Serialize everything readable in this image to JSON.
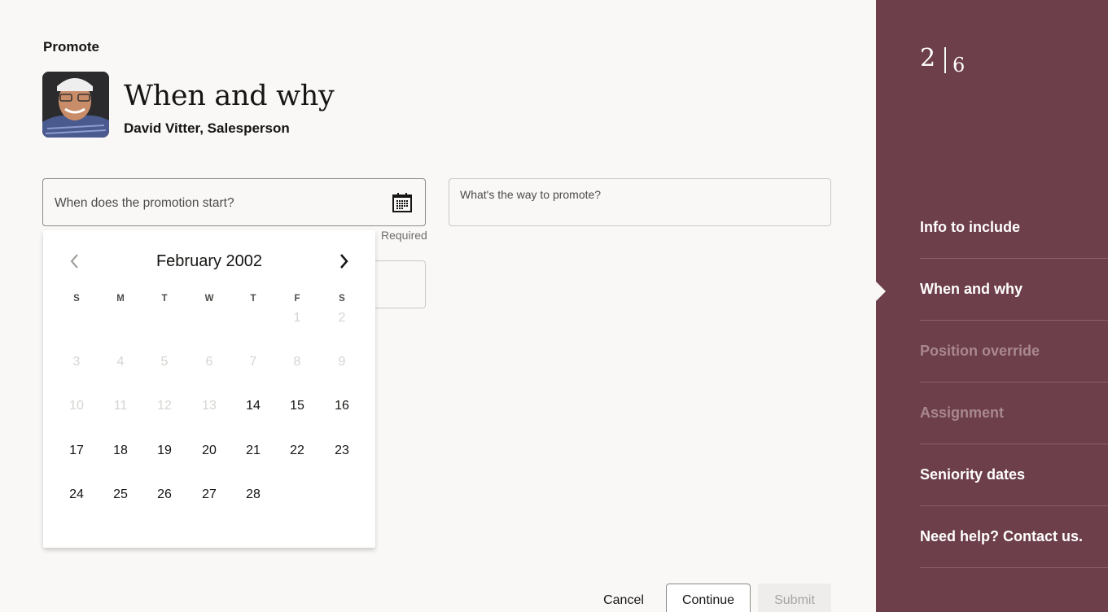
{
  "header": {
    "eyebrow": "Promote",
    "title": "When and why",
    "subtitle": "David Vitter, Salesperson"
  },
  "form": {
    "start_date": {
      "placeholder": "When does the promotion start?",
      "helper": "Required",
      "icon": "calendar-icon"
    },
    "way": {
      "placeholder": "What's the way to promote?"
    }
  },
  "datepicker": {
    "month_label": "February 2002",
    "prev_icon": "chevron-left-icon",
    "next_icon": "chevron-right-icon",
    "weekdays": [
      "S",
      "M",
      "T",
      "W",
      "T",
      "F",
      "S"
    ],
    "weeks": [
      [
        null,
        null,
        null,
        null,
        null,
        {
          "d": "1",
          "disabled": true
        },
        {
          "d": "2",
          "disabled": true
        }
      ],
      [
        {
          "d": "3",
          "disabled": true
        },
        {
          "d": "4",
          "disabled": true
        },
        {
          "d": "5",
          "disabled": true
        },
        {
          "d": "6",
          "disabled": true
        },
        {
          "d": "7",
          "disabled": true
        },
        {
          "d": "8",
          "disabled": true
        },
        {
          "d": "9",
          "disabled": true
        }
      ],
      [
        {
          "d": "10",
          "disabled": true
        },
        {
          "d": "11",
          "disabled": true
        },
        {
          "d": "12",
          "disabled": true
        },
        {
          "d": "13",
          "disabled": true
        },
        {
          "d": "14",
          "disabled": false
        },
        {
          "d": "15",
          "disabled": false
        },
        {
          "d": "16",
          "disabled": false
        }
      ],
      [
        {
          "d": "17",
          "disabled": false
        },
        {
          "d": "18",
          "disabled": false
        },
        {
          "d": "19",
          "disabled": false
        },
        {
          "d": "20",
          "disabled": false
        },
        {
          "d": "21",
          "disabled": false
        },
        {
          "d": "22",
          "disabled": false
        },
        {
          "d": "23",
          "disabled": false
        }
      ],
      [
        {
          "d": "24",
          "disabled": false
        },
        {
          "d": "25",
          "disabled": false
        },
        {
          "d": "26",
          "disabled": false
        },
        {
          "d": "27",
          "disabled": false
        },
        {
          "d": "28",
          "disabled": false
        },
        null,
        null
      ]
    ]
  },
  "actions": {
    "cancel": "Cancel",
    "continue": "Continue",
    "submit": "Submit"
  },
  "sidebar": {
    "current_step": "2",
    "total_steps": "6",
    "steps": [
      {
        "label": "Info to include",
        "state": "enabled"
      },
      {
        "label": "When and why",
        "state": "current"
      },
      {
        "label": "Position override",
        "state": "disabled"
      },
      {
        "label": "Assignment",
        "state": "disabled"
      },
      {
        "label": "Seniority dates",
        "state": "enabled"
      },
      {
        "label": "Need help? Contact us.",
        "state": "enabled"
      }
    ]
  },
  "colors": {
    "sidebar_bg": "#6d3f4a",
    "page_bg": "#f9f8f6",
    "text": "#161513",
    "disabled_day": "#d6d4d1"
  }
}
